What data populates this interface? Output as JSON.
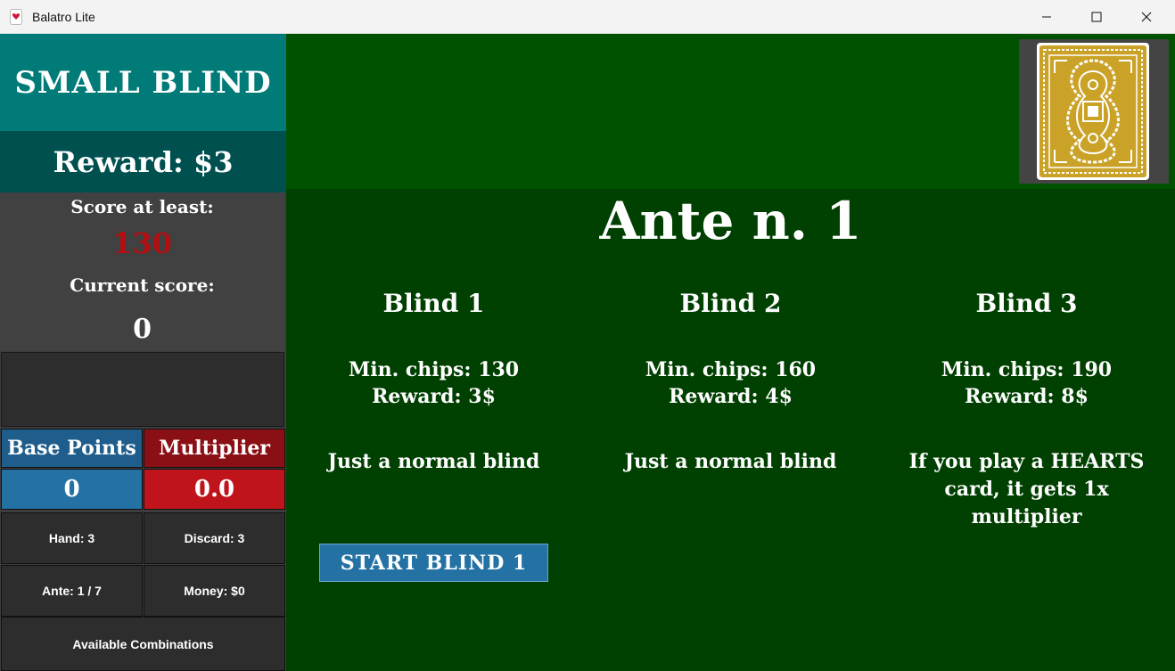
{
  "window": {
    "title": "Balatro Lite"
  },
  "left_panel": {
    "blind_name": "SMALL BLIND",
    "reward": "Reward: $3",
    "score_label": "Score at least:",
    "score_target": "130",
    "current_label": "Current score:",
    "current_score": "0",
    "base_points_label": "Base Points",
    "multiplier_label": "Multiplier",
    "base_points_value": "0",
    "multiplier_value": "0.0",
    "hand": "Hand: 3",
    "discard": "Discard: 3",
    "ante": "Ante: 1 / 7",
    "money": "Money: $0",
    "combinations_button": "Available Combinations"
  },
  "main": {
    "ante_title": "Ante n. 1",
    "blinds": [
      {
        "title": "Blind 1",
        "chips": "Min. chips: 130",
        "reward": "Reward: 3$",
        "description": "Just a normal blind"
      },
      {
        "title": "Blind 2",
        "chips": "Min. chips: 160",
        "reward": "Reward: 4$",
        "description": "Just a normal blind"
      },
      {
        "title": "Blind 3",
        "chips": "Min. chips: 190",
        "reward": "Reward: 8$",
        "description": "If you play a HEARTS card, it gets 1x multiplier"
      }
    ],
    "start_button": "START BLIND 1"
  },
  "icons": {
    "app": "card-heart-icon",
    "deck": "card-back-icon"
  },
  "colors": {
    "teal": "#007b78",
    "dark_teal": "#005050",
    "felt_top": "#005200",
    "felt_main": "#004000",
    "blue": "#2471a3",
    "red": "#c0141c",
    "score_red": "#b30f12",
    "card_gold": "#c9a227"
  }
}
